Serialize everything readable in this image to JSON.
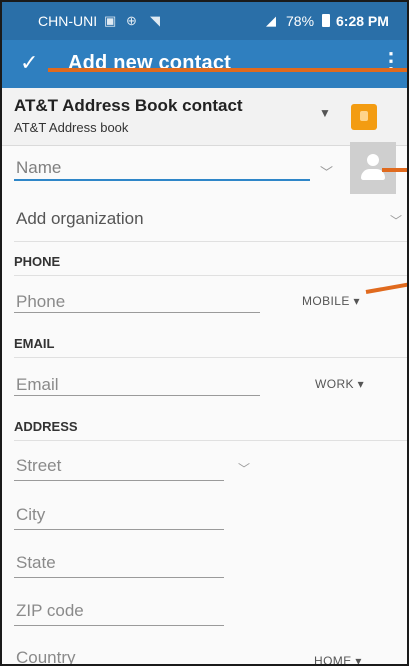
{
  "status_bar": {
    "carrier": "CHN-UNI",
    "battery": "78%",
    "time": "6:28 PM"
  },
  "toolbar": {
    "title": "Add new contact",
    "confirm_icon": "check-icon",
    "menu_icon": "more-vert-icon"
  },
  "account": {
    "title": "AT&T Address Book contact",
    "subtitle": "AT&T Address book",
    "icon": "address-book-icon"
  },
  "name": {
    "placeholder": "Name"
  },
  "organization": {
    "label": "Add organization"
  },
  "sections": {
    "phone": "PHONE",
    "email": "EMAIL",
    "address": "ADDRESS"
  },
  "phone": {
    "placeholder": "Phone",
    "type": "MOBILE ▾"
  },
  "email": {
    "placeholder": "Email",
    "type": "WORK ▾"
  },
  "address": {
    "street": "Street",
    "city": "City",
    "state": "State",
    "zip": "ZIP code",
    "country": "Country",
    "type": "HOME ▾"
  },
  "colors": {
    "status_bar": "#2a6fa8",
    "toolbar": "#2f7fbf",
    "accent": "#2e86c8",
    "callout": "#e06a1e"
  }
}
